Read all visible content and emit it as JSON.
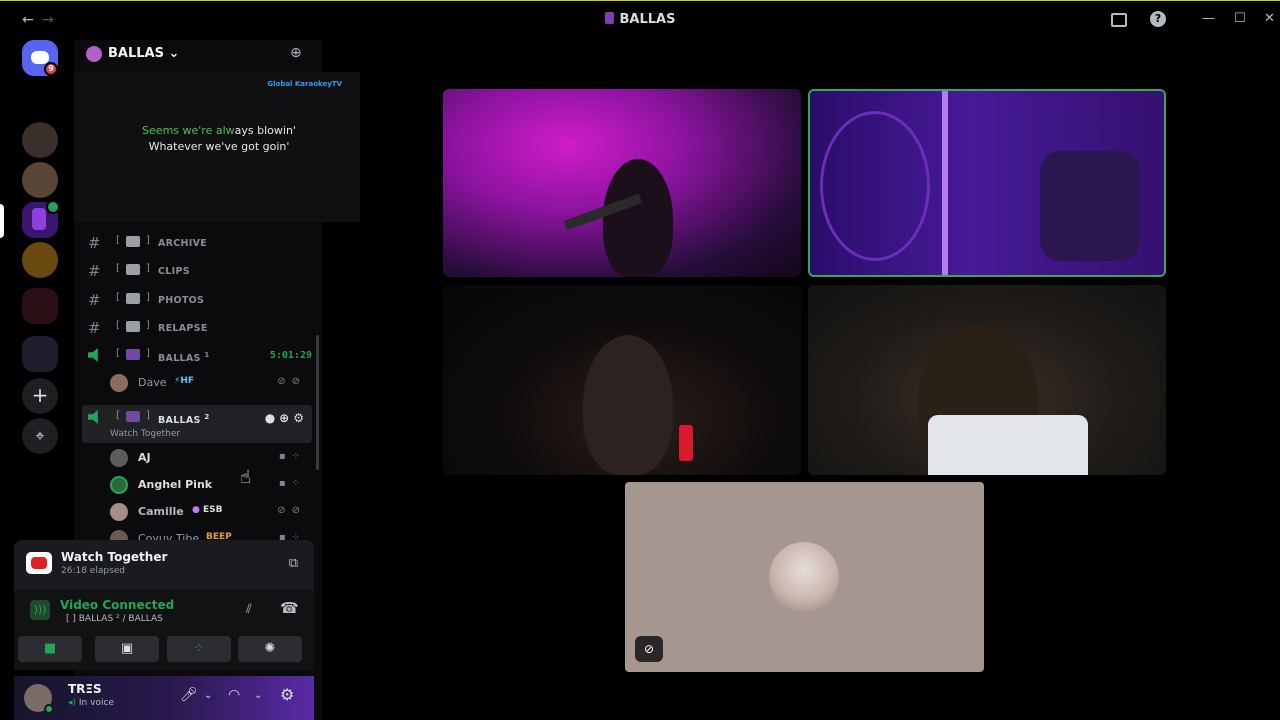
{
  "window": {
    "title": "BALLAS",
    "back": "←",
    "forward": "→",
    "help": "?",
    "minimize": "—",
    "maximize": "☐",
    "close": "✕",
    "screen_icon": "screen-share-icon"
  },
  "servers": {
    "home_badge": "9",
    "add": "+",
    "discover": "⌖"
  },
  "guild": {
    "name": "BALLAS ⌄",
    "invite_icon": "add-member-icon"
  },
  "banner": {
    "brand": "Global KaraokeyTV",
    "line1_sung": "Seems we're alw",
    "line1_rest": "ays blowin'",
    "line2": "Whatever we've got goin'"
  },
  "channels": [
    {
      "name": "ARCHIVE",
      "type": "text"
    },
    {
      "name": "CLIPS",
      "type": "text"
    },
    {
      "name": "PHOTOS",
      "type": "text"
    },
    {
      "name": "RELAPSE",
      "type": "text"
    }
  ],
  "voice1": {
    "bracket": "[",
    "close": "]",
    "name": "BALLAS",
    "sup": "1",
    "timer": "5:01:29",
    "members": [
      {
        "name": "Dave",
        "tag": "⚡HF"
      }
    ]
  },
  "voice2": {
    "bracket": "[",
    "close": "]",
    "name": "BALLAS",
    "sup": "2",
    "activity": "Watch Together",
    "members": [
      {
        "name": "AJ",
        "tag": ""
      },
      {
        "name": "Anghel Pink",
        "tag": ""
      },
      {
        "name": "Camille",
        "tag": "ESB"
      },
      {
        "name": "Coyuv Tibe",
        "tag": "BEEP"
      }
    ]
  },
  "activity_panel": {
    "title": "Watch Together",
    "elapsed": "26:18 elapsed"
  },
  "voice_status": {
    "status": "Video Connected",
    "location": "[ ] BALLAS ² / BALLAS"
  },
  "user": {
    "name": "TRΞS",
    "status": "In voice"
  },
  "colors": {
    "green": "#23a559",
    "bg": "#000000",
    "channel_bg": "#0b0b0d",
    "accent_purple": "#5b2aa8"
  }
}
